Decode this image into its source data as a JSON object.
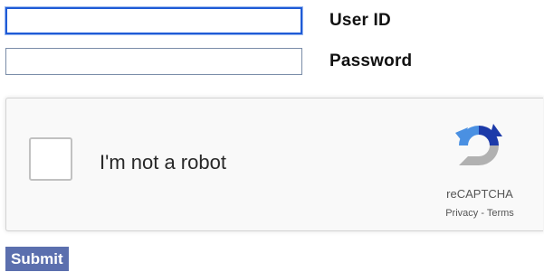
{
  "form": {
    "user_id_label": "User ID",
    "user_id_value": "",
    "password_label": "Password",
    "password_value": ""
  },
  "recaptcha": {
    "checkbox_label": "I'm not a robot",
    "checked": false,
    "brand": "reCAPTCHA",
    "privacy_link": "Privacy",
    "separator": " - ",
    "terms_link": "Terms",
    "logo_icon": "recaptcha-logo-icon",
    "colors": {
      "blue": "#4a90e2",
      "dark_blue": "#1c3aa9",
      "gray": "#b1b1b1"
    }
  },
  "actions": {
    "submit_label": "Submit"
  },
  "colors": {
    "submit_background": "#5b6fae",
    "focus_border": "#1f5bd6"
  }
}
